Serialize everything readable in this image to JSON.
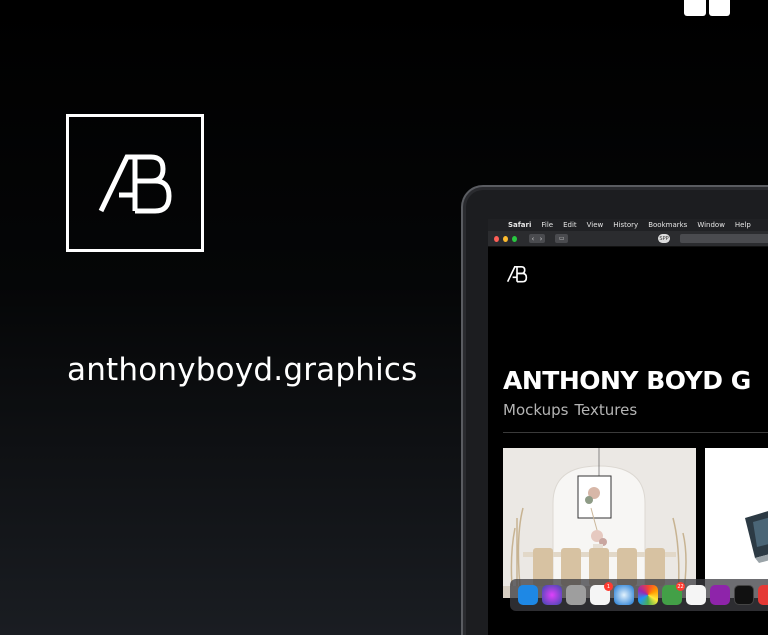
{
  "brand": {
    "site_name": "anthonyboyd.graphics",
    "logo_icon": "ab-monogram-icon",
    "corner_icon": "book-icon"
  },
  "browser": {
    "menubar": {
      "items": [
        "Safari",
        "File",
        "Edit",
        "View",
        "History",
        "Bookmarks",
        "Window",
        "Help"
      ]
    },
    "privacy_label": "SPP"
  },
  "website": {
    "title": "ANTHONY BOYD G",
    "nav": [
      "Mockups",
      "Textures"
    ]
  },
  "dock": {
    "icons": [
      {
        "name": "finder-icon",
        "color": "#1e88e5"
      },
      {
        "name": "siri-icon",
        "color": "#5e35b1"
      },
      {
        "name": "launchpad-icon",
        "color": "#9e9e9e"
      },
      {
        "name": "reminders-icon",
        "color": "#f5f5f5",
        "badge": "1"
      },
      {
        "name": "safari-icon",
        "color": "#1976d2"
      },
      {
        "name": "photos-icon",
        "color": "#fbc02d"
      },
      {
        "name": "facetime-icon",
        "color": "#43a047",
        "badge": "22"
      },
      {
        "name": "music-icon",
        "color": "#f5f5f5"
      },
      {
        "name": "podcasts-icon",
        "color": "#8e24aa"
      },
      {
        "name": "apple-tv-icon",
        "color": "#111111"
      },
      {
        "name": "news-icon",
        "color": "#e53935"
      }
    ]
  },
  "colors": {
    "accent_red": "#ff5f57",
    "accent_yellow": "#febc2e",
    "accent_green": "#28c840"
  }
}
